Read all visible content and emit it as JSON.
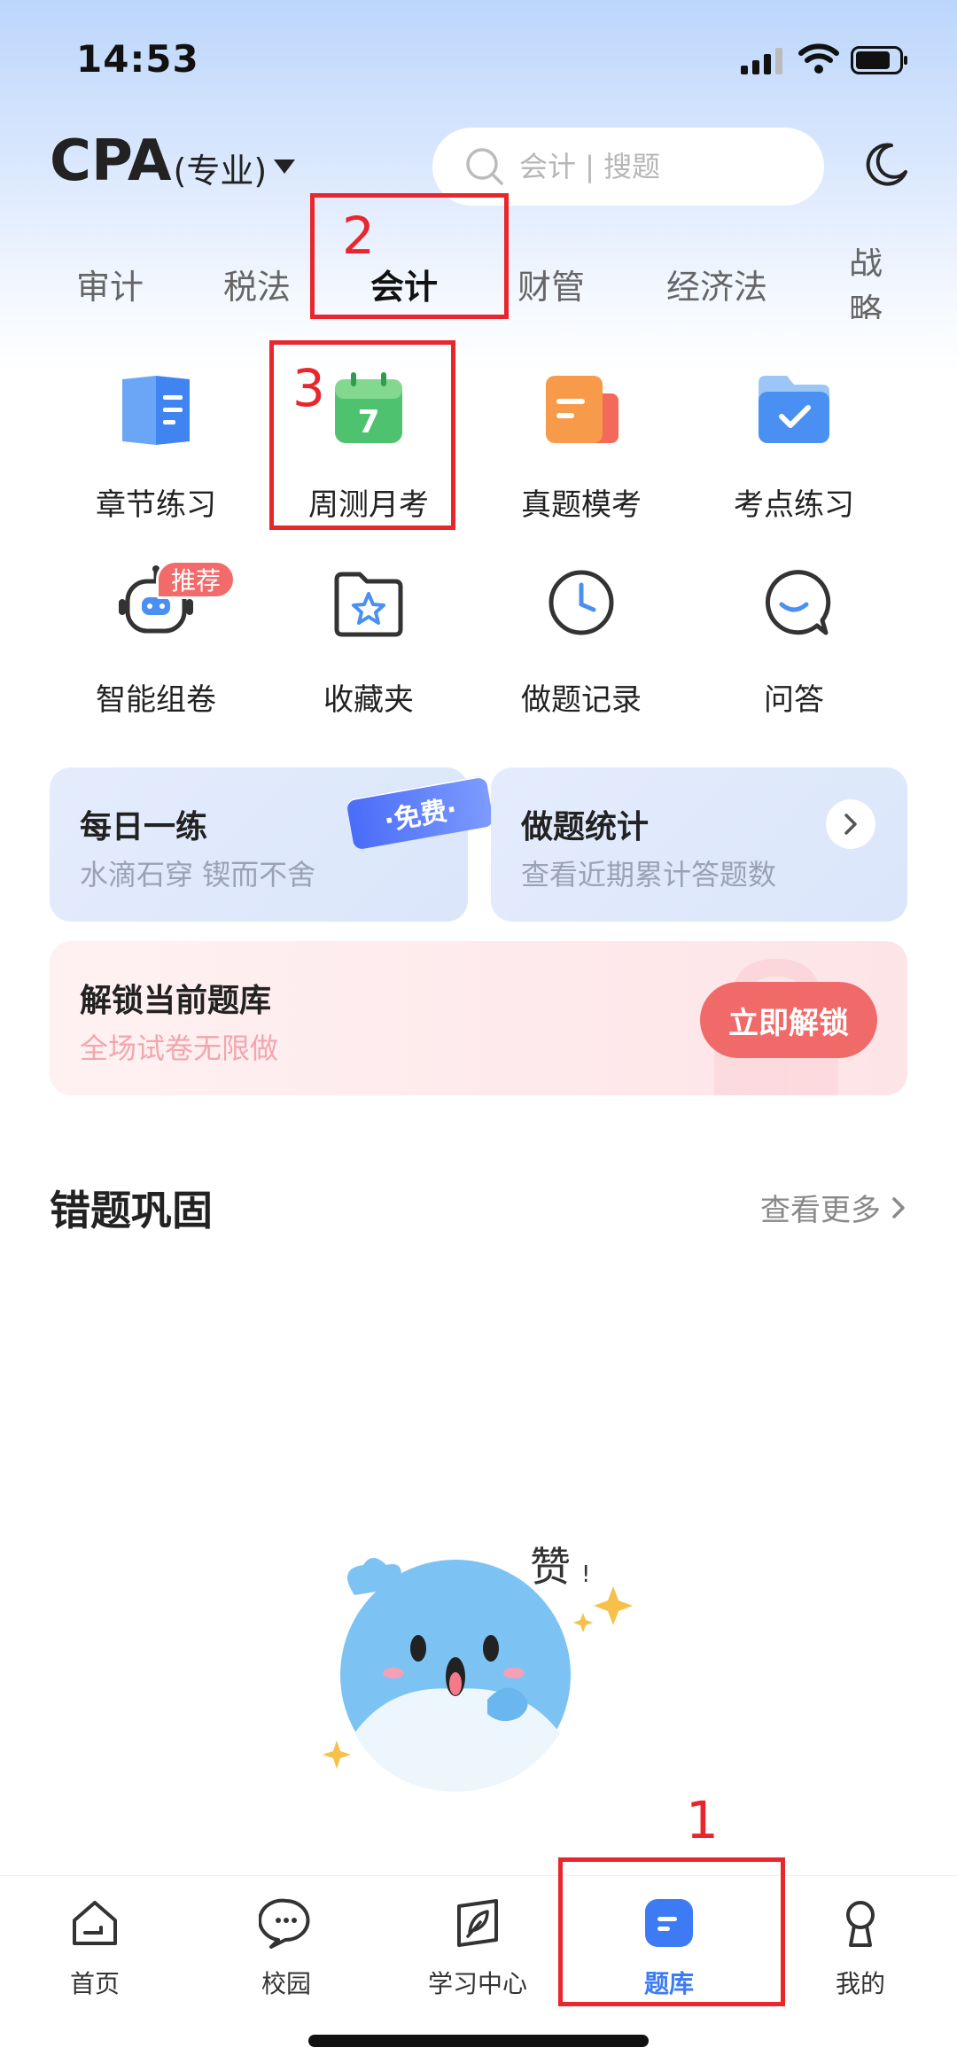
{
  "status_bar": {
    "time": "14:53"
  },
  "header": {
    "title": "CPA",
    "subtitle": "(专业)",
    "search_placeholder": "会计 | 搜题"
  },
  "tabs": [
    {
      "label": "审计",
      "active": false
    },
    {
      "label": "税法",
      "active": false
    },
    {
      "label": "会计",
      "active": true
    },
    {
      "label": "财管",
      "active": false
    },
    {
      "label": "经济法",
      "active": false
    },
    {
      "label": "战略",
      "active": false
    }
  ],
  "grid": [
    {
      "label": "章节练习",
      "icon": "book-icon"
    },
    {
      "label": "周测月考",
      "icon": "calendar-icon",
      "icon_text": "7"
    },
    {
      "label": "真题模考",
      "icon": "document-icon"
    },
    {
      "label": "考点练习",
      "icon": "folder-check-icon"
    },
    {
      "label": "智能组卷",
      "icon": "robot-icon",
      "badge": "推荐"
    },
    {
      "label": "收藏夹",
      "icon": "folder-star-icon"
    },
    {
      "label": "做题记录",
      "icon": "clock-icon"
    },
    {
      "label": "问答",
      "icon": "chat-smile-icon"
    }
  ],
  "cards": {
    "daily": {
      "title": "每日一练",
      "subtitle": "水滴石穿 锲而不舍",
      "tag": "·免费·"
    },
    "stats": {
      "title": "做题统计",
      "subtitle": "查看近期累计答题数"
    },
    "unlock": {
      "title": "解锁当前题库",
      "subtitle": "全场试卷无限做",
      "button": "立即解锁"
    }
  },
  "wrong_section": {
    "title": "错题巩固",
    "more": "查看更多",
    "illus_text": "赞",
    "illus_excl": "!"
  },
  "bottom_nav": [
    {
      "label": "首页",
      "icon": "home-icon",
      "active": false
    },
    {
      "label": "校园",
      "icon": "campus-chat-icon",
      "active": false
    },
    {
      "label": "学习中心",
      "icon": "leaf-book-icon",
      "active": false
    },
    {
      "label": "题库",
      "icon": "question-bank-icon",
      "active": true
    },
    {
      "label": "我的",
      "icon": "person-icon",
      "active": false
    }
  ],
  "annotations": [
    "1",
    "2",
    "3"
  ],
  "colors": {
    "accent": "#3d7bf5",
    "annotation": "#e8262b",
    "unlock": "#f06a6a"
  }
}
